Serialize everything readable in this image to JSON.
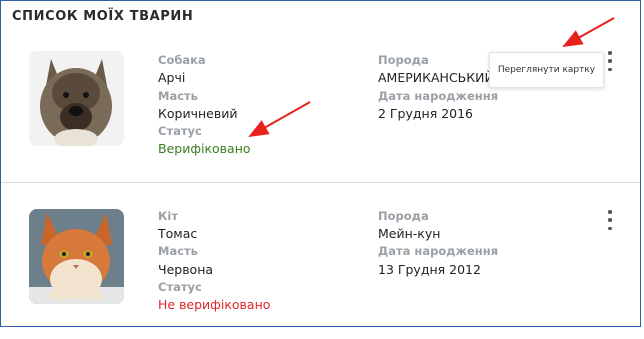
{
  "page": {
    "title": "СПИСОК МОЇХ ТВАРИН"
  },
  "pets": [
    {
      "type_label": "Собака",
      "name": "Арчі",
      "color_label": "Масть",
      "color": "Коричневий",
      "status_label": "Статус",
      "status": "Верифіковано",
      "breed_label": "Порода",
      "breed": "АМЕРИКАНСЬКИЙ",
      "dob_label": "Дата народження",
      "dob": "2 Грудня 2016"
    },
    {
      "type_label": "Кіт",
      "name": "Томас",
      "color_label": "Масть",
      "color": "Червона",
      "status_label": "Статус",
      "status": "Не верифіковано",
      "breed_label": "Порода",
      "breed": "Мейн-кун",
      "dob_label": "Дата народження",
      "dob": "13 Грудня 2012"
    }
  ],
  "menu": {
    "view_card": "Переглянути картку"
  },
  "colors": {
    "verified": "#3a7d22",
    "not_verified": "#e0262b",
    "annotation_arrow": "#e8211b",
    "frame": "#2f5fa8"
  }
}
